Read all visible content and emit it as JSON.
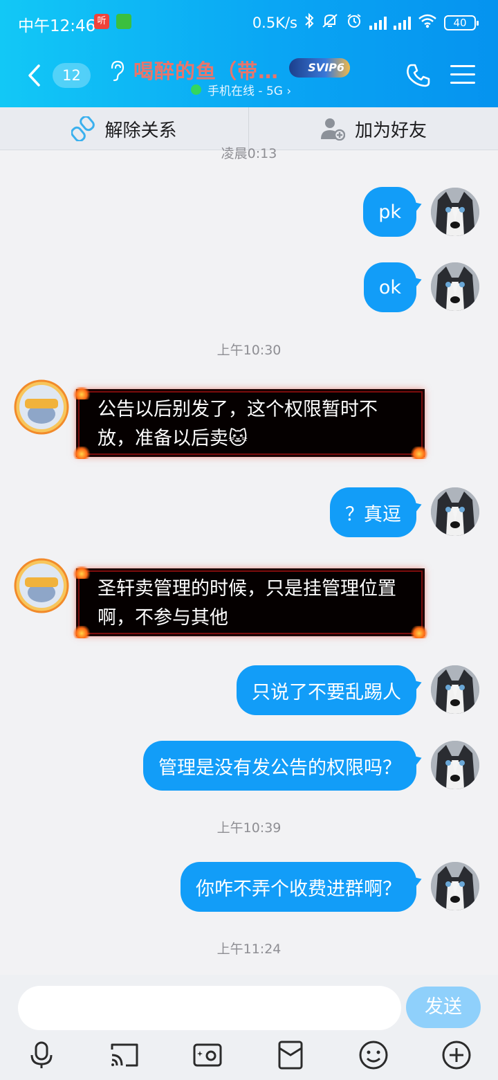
{
  "status_bar": {
    "time": "中午12:46",
    "app_badge": "听",
    "network_speed": "0.5K/s",
    "battery": "40"
  },
  "header": {
    "unread_count": "12",
    "title": "喝醉的鱼（带…",
    "vip_badge": "SVIP6",
    "online_status": "手机在线 - 5G ›",
    "colors": {
      "gradient_start": "#12c8f6",
      "gradient_end": "#0593ef",
      "title": "#e8756b"
    }
  },
  "actions": {
    "unlink_label": "解除关系",
    "add_friend_label": "加为好友"
  },
  "messages": [
    {
      "type": "time",
      "text": "凌晨0:13"
    },
    {
      "type": "out",
      "text": "pk"
    },
    {
      "type": "out",
      "text": "ok"
    },
    {
      "type": "time",
      "text": "上午10:30"
    },
    {
      "type": "in",
      "text": "公告以后别发了，这个权限暂时不放，准备以后卖🐱"
    },
    {
      "type": "out",
      "text": "？真逗"
    },
    {
      "type": "in",
      "text": "圣轩卖管理的时候，只是挂管理位置啊，不参与其他"
    },
    {
      "type": "out",
      "text": "只说了不要乱踢人"
    },
    {
      "type": "out",
      "text": "管理是没有发公告的权限吗？"
    },
    {
      "type": "time",
      "text": "上午10:39"
    },
    {
      "type": "out",
      "text": "你咋不弄个收费进群啊？"
    },
    {
      "type": "time",
      "text": "上午11:24"
    }
  ],
  "input": {
    "placeholder": "",
    "send_label": "发送"
  },
  "toolbar_icons": [
    "microphone-icon",
    "screen-cast-icon",
    "photo-icon",
    "red-packet-icon",
    "emoji-icon",
    "plus-icon"
  ]
}
